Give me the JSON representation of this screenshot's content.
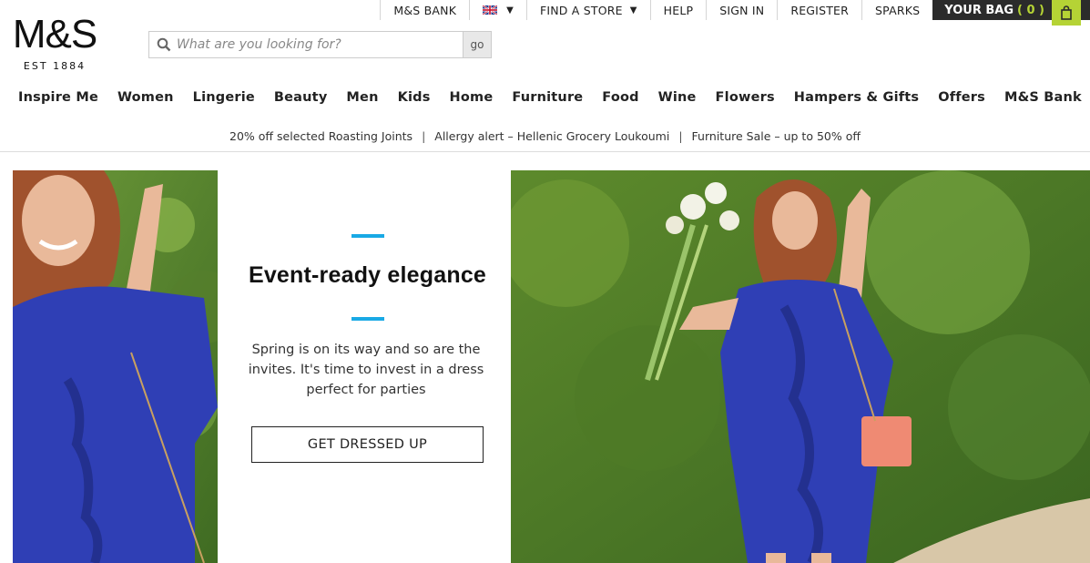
{
  "utility": {
    "bank": "M&S BANK",
    "store": "FIND A STORE",
    "help": "HELP",
    "signin": "SIGN IN",
    "register": "REGISTER",
    "sparks": "SPARKS",
    "bag_label": "YOUR BAG",
    "bag_count": "( 0 )"
  },
  "logo": {
    "main": "M&S",
    "sub": "EST 1884"
  },
  "search": {
    "placeholder": "What are you looking for?",
    "button": "go"
  },
  "nav": [
    "Inspire Me",
    "Women",
    "Lingerie",
    "Beauty",
    "Men",
    "Kids",
    "Home",
    "Furniture",
    "Food",
    "Wine",
    "Flowers",
    "Hampers & Gifts",
    "Offers",
    "M&S Bank"
  ],
  "promos": [
    "20% off selected Roasting Joints",
    "Allergy alert – Hellenic Grocery Loukoumi",
    "Furniture Sale – up to 50% off"
  ],
  "promo_sep": "|",
  "hero": {
    "title": "Event-ready elegance",
    "body": "Spring is on its way and so are the invites. It's time to invest in a dress perfect for parties",
    "cta": "GET DRESSED UP"
  },
  "colors": {
    "accent": "#19a9e5",
    "bag_green": "#b5d335",
    "bag_bg": "#2b2b2b",
    "dress_blue": "#2f3fb5"
  },
  "icons": {
    "search": "search-icon",
    "bag": "shopping-bag-icon",
    "flag": "uk-flag-icon",
    "caret": "caret-down-icon"
  }
}
